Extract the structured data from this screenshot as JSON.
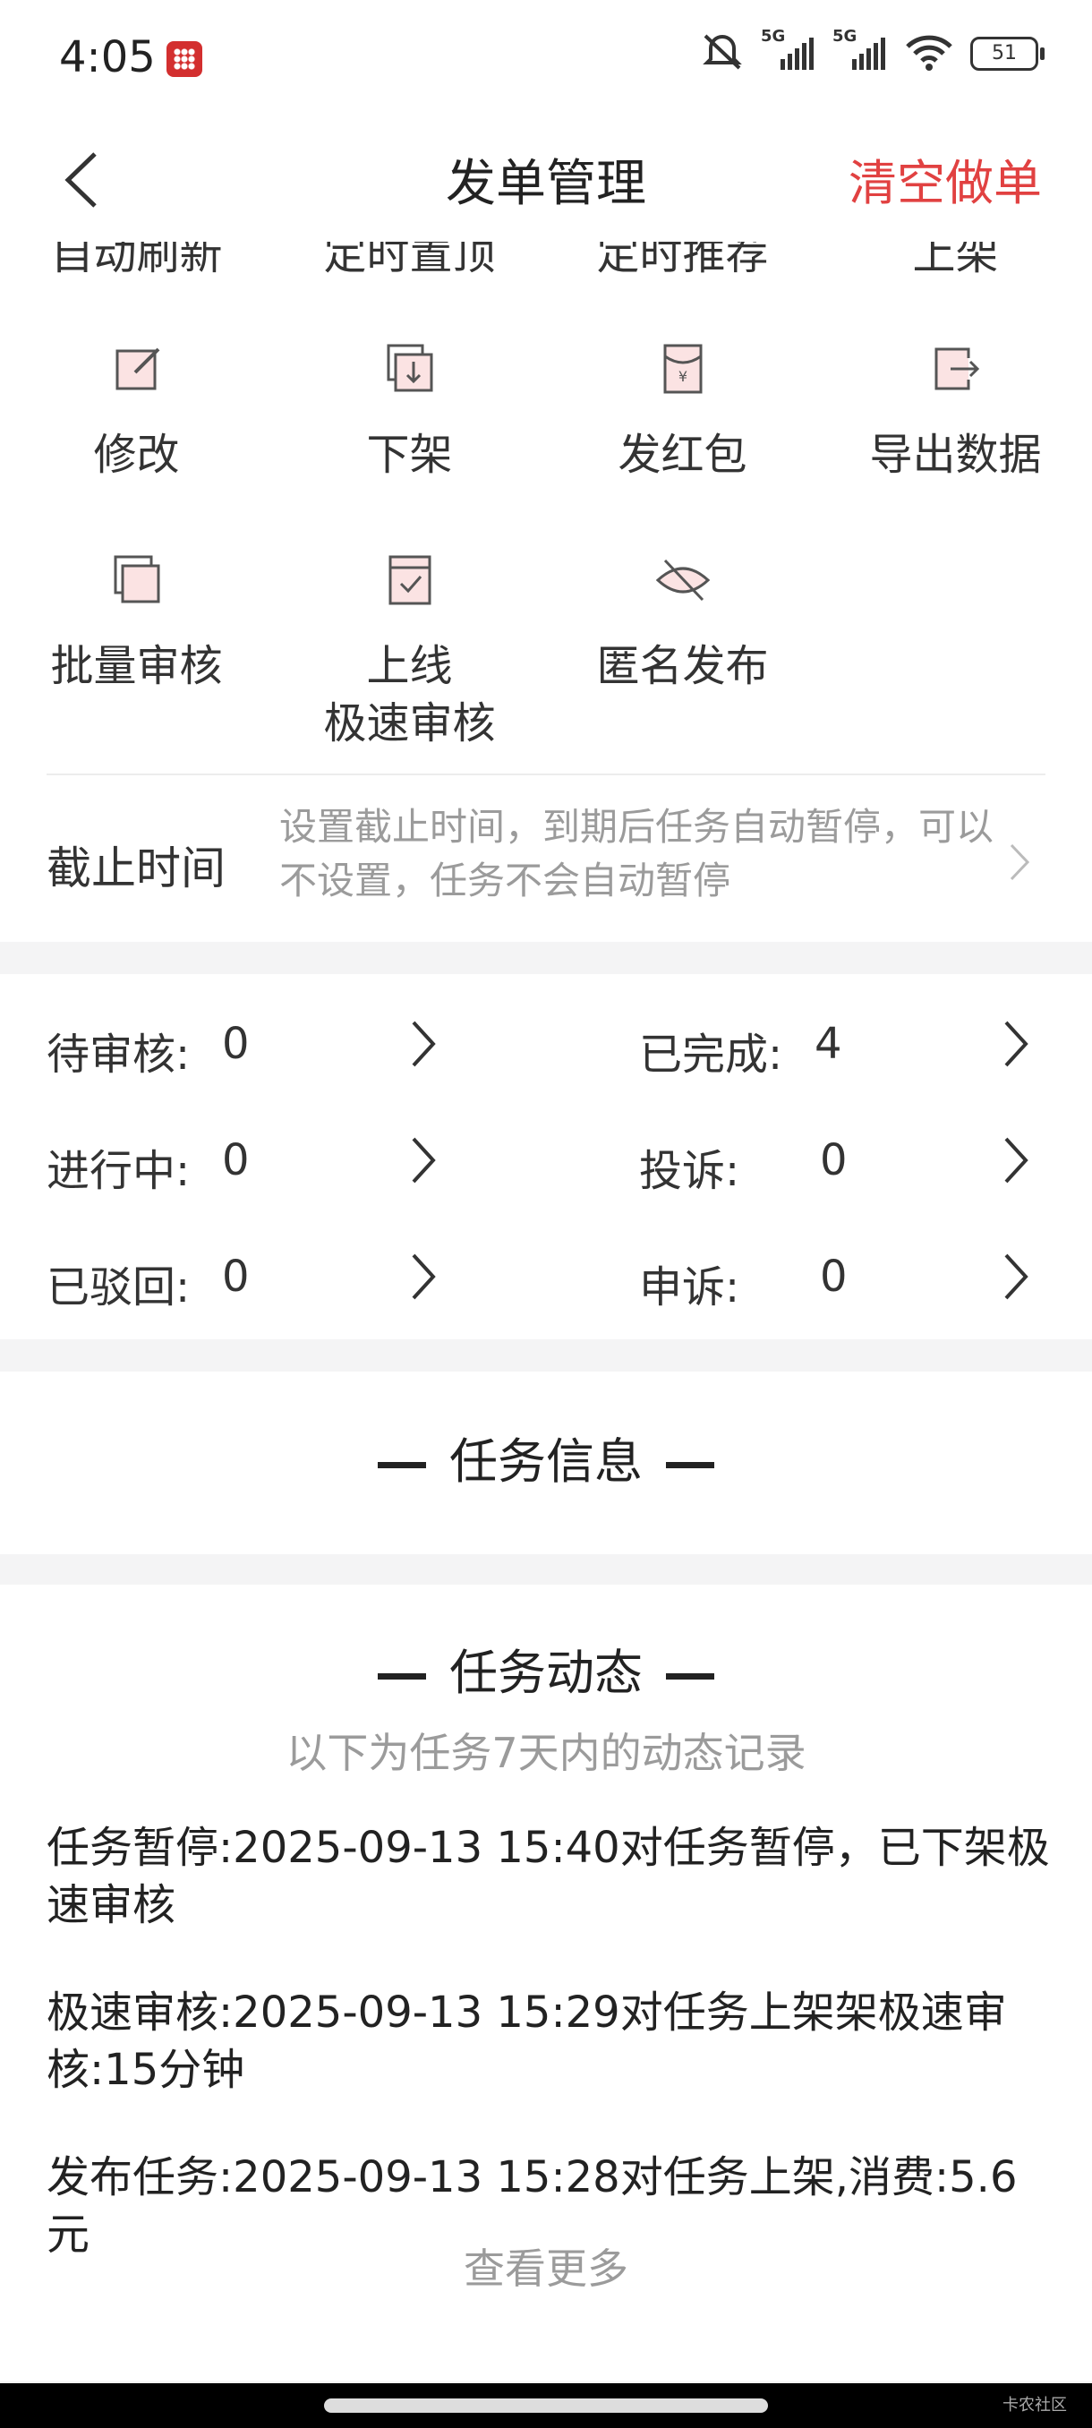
{
  "status_bar": {
    "time": "4:05",
    "network_1": "5G",
    "network_2": "5G",
    "battery": "51"
  },
  "header": {
    "title": "发单管理",
    "clear_label": "清空做单"
  },
  "cut_row": [
    "自动刷新",
    "定时置顶",
    "定时推荐",
    "上架"
  ],
  "ops_row1": [
    {
      "label": "修改",
      "icon": "edit-icon"
    },
    {
      "label": "下架",
      "icon": "takedown-icon"
    },
    {
      "label": "发红包",
      "icon": "red-envelope-icon"
    },
    {
      "label": "导出数据",
      "icon": "export-icon"
    }
  ],
  "ops_row2": [
    {
      "label": "批量审核",
      "icon": "batch-review-icon"
    },
    {
      "label": "上线\n极速审核",
      "icon": "fast-review-icon"
    },
    {
      "label": "匿名发布",
      "icon": "eye-off-icon"
    }
  ],
  "deadline": {
    "label": "截止时间",
    "hint": "设置截止时间，到期后任务自动暂停，可以不设置，任务不会自动暂停"
  },
  "stats": {
    "pending_label": "待审核:",
    "pending_value": "0",
    "done_label": "已完成:",
    "done_value": "4",
    "progress_label": "进行中:",
    "progress_value": "0",
    "complaint_label": "投诉:",
    "complaint_value": "0",
    "rejected_label": "已驳回:",
    "rejected_value": "0",
    "appeal_label": "申诉:",
    "appeal_value": "0"
  },
  "task_info": {
    "title": "任务信息"
  },
  "task_dynamic": {
    "title": "任务动态",
    "subtitle": "以下为任务7天内的动态记录",
    "logs": [
      "任务暂停:2025-09-13 15:40对任务暂停，已下架极速审核",
      "极速审核:2025-09-13 15:29对任务上架架极速审核:15分钟",
      "发布任务:2025-09-13 15:28对任务上架,消费:5.6元"
    ],
    "more": "查看更多"
  },
  "watermark": "卡农社区",
  "colors": {
    "accent": "#e14141",
    "icon_fill": "#fbe3e3"
  }
}
